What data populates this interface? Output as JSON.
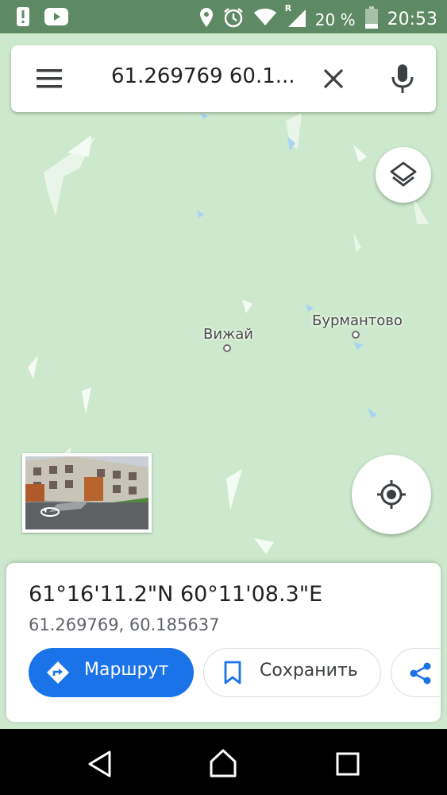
{
  "status_bar": {
    "battery_percent": "20 %",
    "time": "20:53",
    "network_badge": "R",
    "icons": [
      "alert-icon",
      "youtube-icon",
      "location-icon",
      "alarm-icon",
      "wifi-icon",
      "signal-icon",
      "battery-icon"
    ]
  },
  "search": {
    "query": "61.269769 60.1..."
  },
  "map": {
    "places": [
      {
        "name": "Вижай"
      },
      {
        "name": "Бурмантово"
      }
    ]
  },
  "place_sheet": {
    "title": "61°16'11.2\"N 60°11'08.3\"E",
    "subtitle": "61.269769, 60.185637",
    "route_label": "Маршрут",
    "save_label": "Сохранить"
  },
  "colors": {
    "map_bg": "#cde9cd",
    "status_bar": "#5d8a62",
    "accent": "#1a73e8",
    "water": "#a8d4f0"
  }
}
